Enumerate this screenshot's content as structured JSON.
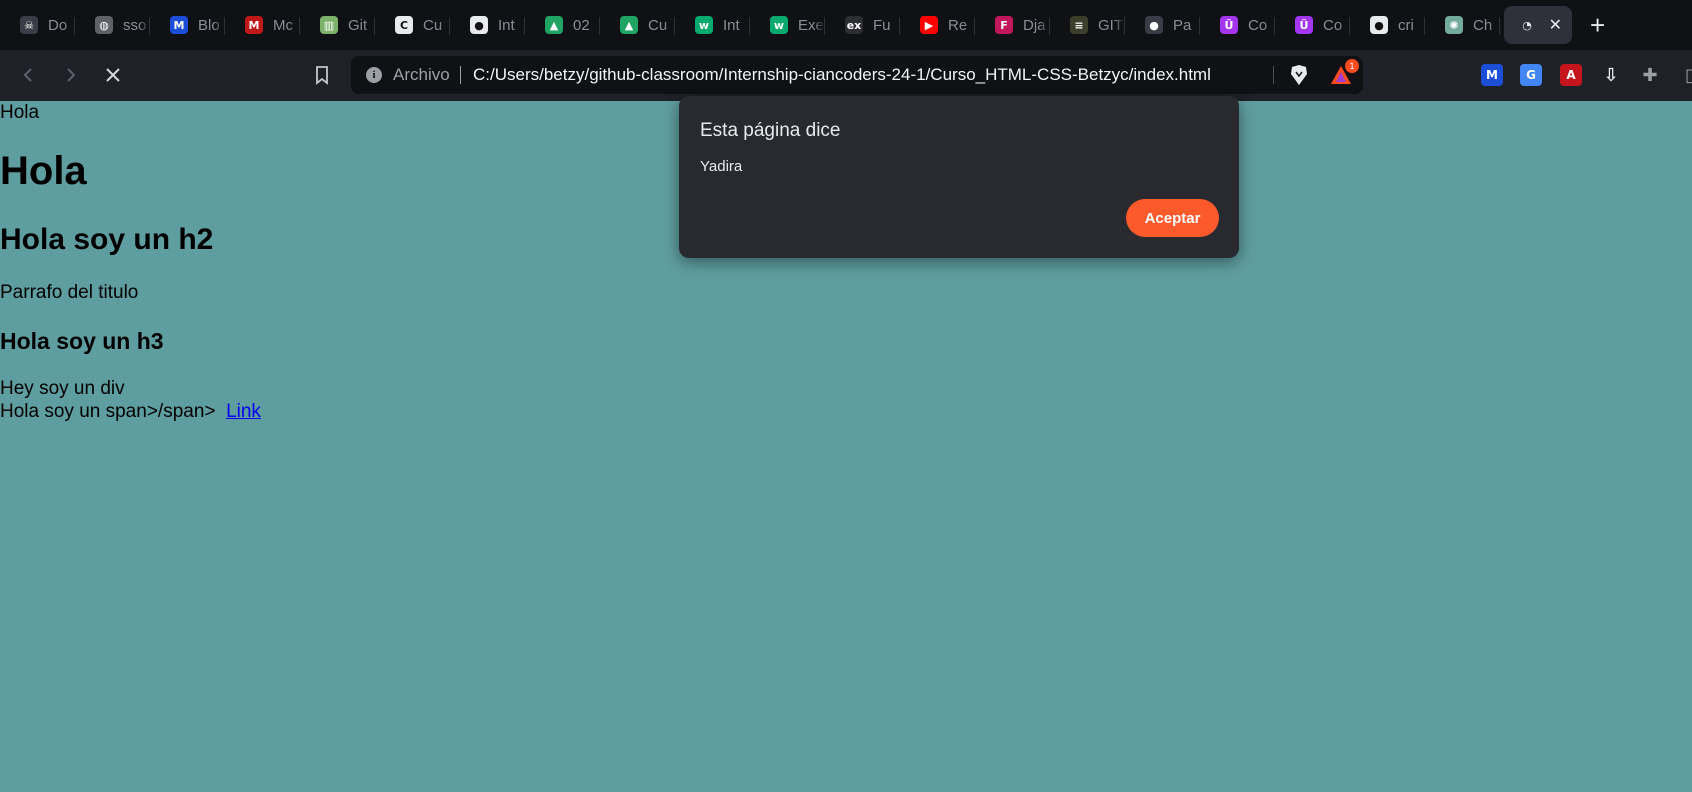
{
  "tabs": [
    {
      "icon": "dark-mask-icon",
      "label": "Do",
      "color": "#3a3d45"
    },
    {
      "icon": "globe-icon",
      "label": "sso",
      "color": "#5f6368"
    },
    {
      "icon": "malwarebytes-icon",
      "label": "Blo",
      "color": "#1d4ed8"
    },
    {
      "icon": "mcafee-icon",
      "label": "Mc",
      "color": "#c01818"
    },
    {
      "icon": "books-icon",
      "label": "Git",
      "color": "#7cb26a"
    },
    {
      "icon": "cursos-icon",
      "label": "Cu",
      "color": "#e8eaed"
    },
    {
      "icon": "github-icon",
      "label": "Int",
      "color": "#e8eaed"
    },
    {
      "icon": "google-drive-icon",
      "label": "02",
      "color": "#1fa463"
    },
    {
      "icon": "google-drive-icon",
      "label": "Cu",
      "color": "#1fa463"
    },
    {
      "icon": "w3schools-icon",
      "label": "Int",
      "color": "#04aa6d"
    },
    {
      "icon": "w3schools-icon",
      "label": "Exe",
      "color": "#04aa6d"
    },
    {
      "icon": "edx-icon",
      "label": "Fu",
      "color": "#2b2d31"
    },
    {
      "icon": "youtube-icon",
      "label": "Re",
      "color": "#ff0000"
    },
    {
      "icon": "django-icon",
      "label": "Dja",
      "color": "#c2185b"
    },
    {
      "icon": "terminal-icon",
      "label": "GIT",
      "color": "#3b3f2a"
    },
    {
      "icon": "github-dim-icon",
      "label": "Pa",
      "color": "#3a3d45"
    },
    {
      "icon": "udemy-icon",
      "label": "Co",
      "color": "#a435f0"
    },
    {
      "icon": "udemy-icon",
      "label": "Co",
      "color": "#a435f0"
    },
    {
      "icon": "github-icon",
      "label": "cri",
      "color": "#e8eaed"
    },
    {
      "icon": "chatgpt-icon",
      "label": "Ch",
      "color": "#74aa9c"
    }
  ],
  "active_tab": {
    "icon": "loading-icon",
    "label": ""
  },
  "toolbar": {
    "scheme_label": "Archivo",
    "url": "C:/Users/betzy/github-classroom/Internship-ciancoders-24-1/Curso_HTML-CSS-Betzyc/index.html",
    "rewards_count": "1",
    "extensions": [
      {
        "icon": "malwarebytes-icon",
        "color": "#1d4ed8"
      },
      {
        "icon": "google-translate-icon",
        "color": "#4285f4"
      },
      {
        "icon": "adobe-pdf-icon",
        "color": "#c4151c"
      },
      {
        "icon": "save-to-device-icon",
        "color": "#e8eaed"
      },
      {
        "icon": "extensions-puzzle-icon",
        "color": "#9aa0a6"
      },
      {
        "icon": "sidebar-icon",
        "color": "#9aa0a6"
      }
    ]
  },
  "page": {
    "plain_text": "Hola",
    "h1": "Hola",
    "h2": "Hola soy un h2",
    "paragraph": "Parrafo del titulo",
    "h3": "Hola soy un h3",
    "div_text": "Hey soy un div",
    "span_text": "Hola soy un span>/span>",
    "link_text": "Link",
    "background": "#5f9ea0"
  },
  "alert": {
    "title": "Esta página dice",
    "message": "Yadira",
    "ok_label": "Aceptar",
    "accent": "#fd5a2b"
  }
}
